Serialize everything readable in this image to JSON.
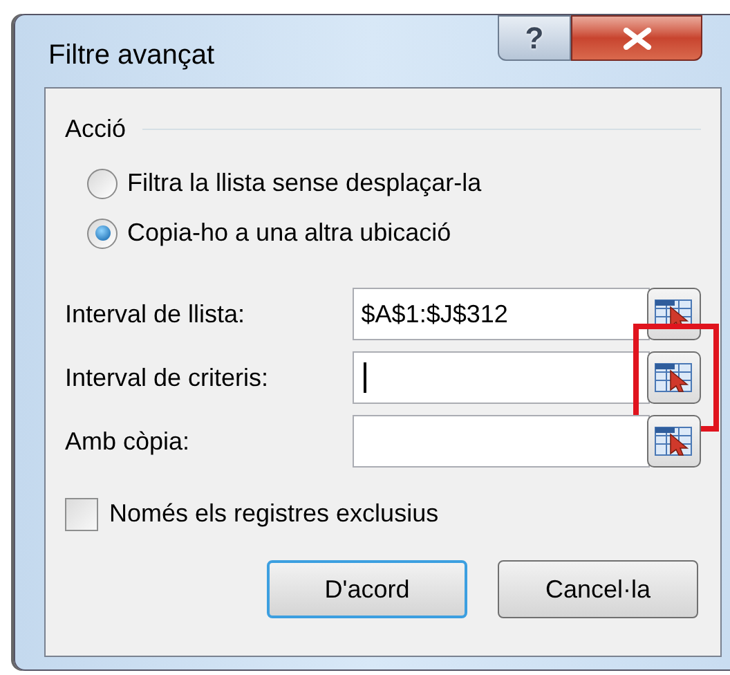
{
  "window": {
    "title": "Filtre avançat",
    "buttons": [
      {
        "kind": "help",
        "label": "?"
      },
      {
        "kind": "close"
      }
    ]
  },
  "action": {
    "label": "Acció",
    "options": [
      {
        "label": "Filtra la llista sense desplaçar-la",
        "selected": false
      },
      {
        "label": "Copia-ho a una altra ubicació",
        "selected": true
      }
    ]
  },
  "ranges": [
    {
      "label": "Interval de llista:",
      "value": "$A$1:$J$312",
      "focused": false,
      "highlighted": false
    },
    {
      "label": "Interval de criteris:",
      "focused": true,
      "highlighted": true
    },
    {
      "label": "Amb còpia:",
      "focused": false,
      "highlighted": false
    }
  ],
  "unique_only": {
    "label": "Només els registres exclusius",
    "checked": false
  },
  "buttons": [
    {
      "label": "D'acord",
      "default": true
    },
    {
      "label": "Cancel·la",
      "default": false
    }
  ]
}
